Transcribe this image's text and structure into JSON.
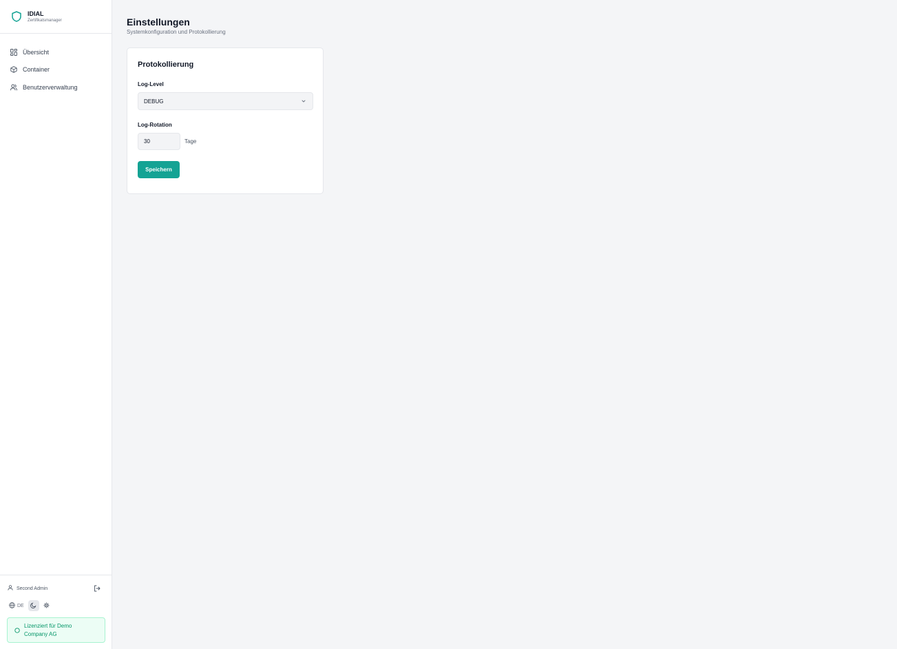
{
  "app": {
    "name": "IDIAL",
    "subtitle": "Zertifikatsmanager"
  },
  "sidebar": {
    "items": [
      {
        "label": "Übersicht",
        "icon": "grid-icon"
      },
      {
        "label": "Container",
        "icon": "box-icon"
      },
      {
        "label": "Benutzerverwaltung",
        "icon": "users-icon"
      }
    ],
    "user": {
      "name": "Second Admin"
    },
    "language": "DE",
    "license": "Lizenziert für Demo Company AG"
  },
  "page": {
    "title": "Einstellungen",
    "subtitle": "Systemkonfiguration und Protokollierung"
  },
  "logging": {
    "title": "Protokollierung",
    "level_label": "Log-Level",
    "level_value": "DEBUG",
    "rotation_label": "Log-Rotation",
    "rotation_value": "30",
    "rotation_unit": "Tage",
    "save_label": "Speichern"
  },
  "colors": {
    "accent": "#14a394",
    "license_bg": "#ecfdf5",
    "license_text": "#059669"
  }
}
